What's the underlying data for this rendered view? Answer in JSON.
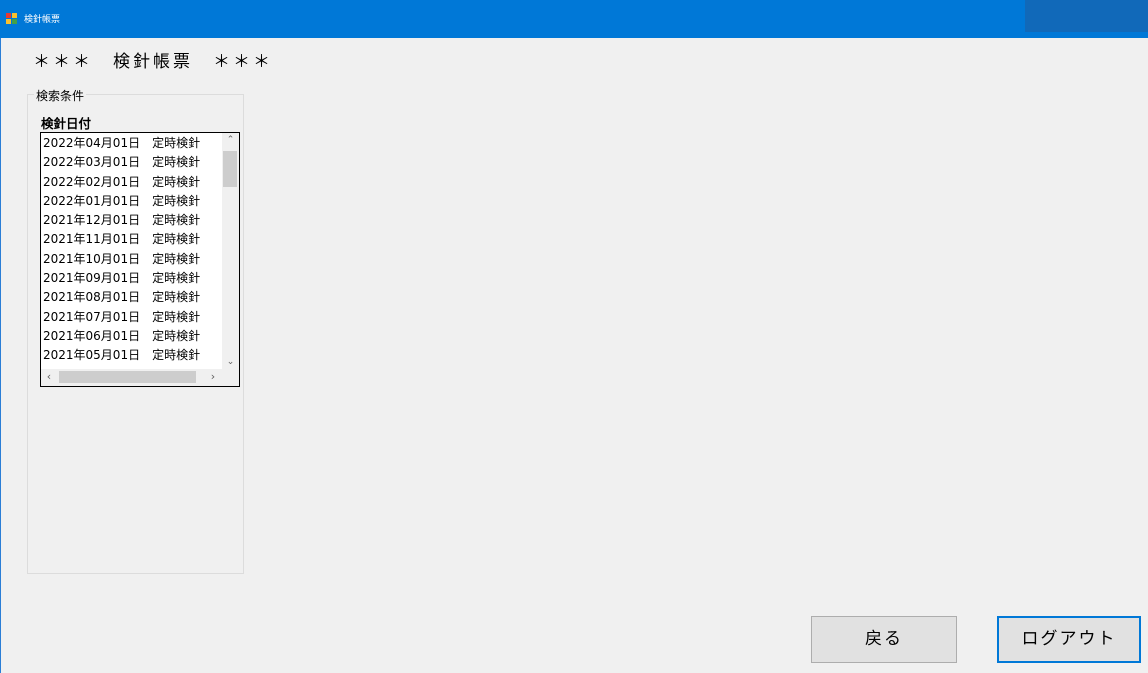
{
  "window": {
    "title": "検針帳票"
  },
  "header": {
    "title": "＊＊＊　検針帳票　＊＊＊"
  },
  "search_group": {
    "label": "検索条件",
    "list_label": "検針日付",
    "items": [
      "2022年04月01日　定時検針",
      "2022年03月01日　定時検針",
      "2022年02月01日　定時検針",
      "2022年01月01日　定時検針",
      "2021年12月01日　定時検針",
      "2021年11月01日　定時検針",
      "2021年10月01日　定時検針",
      "2021年09月01日　定時検針",
      "2021年08月01日　定時検針",
      "2021年07月01日　定時検針",
      "2021年06月01日　定時検針",
      "2021年05月01日　定時検針"
    ]
  },
  "buttons": {
    "back_label": "戻る",
    "logout_label": "ログアウト"
  },
  "colors": {
    "titlebar": "#0078d7",
    "background": "#f0f0f0",
    "focus_border": "#0078d7"
  }
}
